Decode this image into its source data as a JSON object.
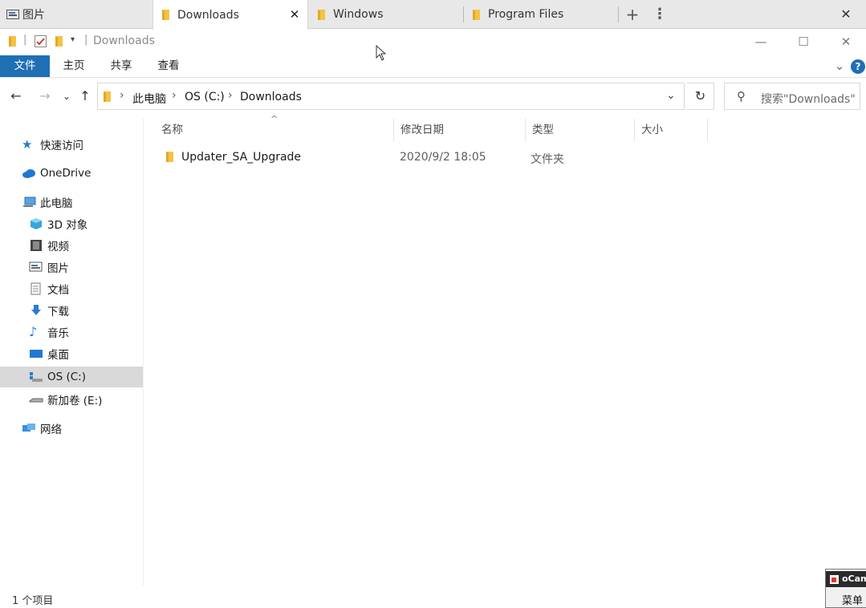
{
  "tabs": [
    {
      "label": "图片",
      "icon": "picture-icon",
      "active": false
    },
    {
      "label": "Downloads",
      "icon": "folder-icon",
      "active": true
    },
    {
      "label": "Windows",
      "icon": "folder-icon",
      "active": false
    },
    {
      "label": "Program Files",
      "icon": "folder-icon",
      "active": false
    }
  ],
  "tab_controls": {
    "close_tab": "✕",
    "new_tab": "+",
    "more": "⋮",
    "close_window": "✕"
  },
  "titlebar": {
    "title": "Downloads",
    "quick_access_divider": "|",
    "quick_access_more": "▾"
  },
  "window_buttons": {
    "minimize": "—",
    "maximize": "☐",
    "close": "✕"
  },
  "ribbon": {
    "tabs": [
      {
        "label": "文件"
      },
      {
        "label": "主页"
      },
      {
        "label": "共享"
      },
      {
        "label": "查看"
      }
    ],
    "expand": "⌄",
    "help": "?"
  },
  "navigation": {
    "back": "←",
    "forward": "→",
    "recent": "⌄",
    "up": "↑",
    "breadcrumb": [
      "此电脑",
      "OS (C:)",
      "Downloads"
    ],
    "breadcrumb_sep": "›",
    "dropdown": "⌄",
    "refresh": "↻",
    "search_placeholder": "搜索\"Downloads\"",
    "search_icon": "⚲"
  },
  "nav_pane": {
    "quick_access": "快速访问",
    "onedrive": "OneDrive",
    "this_pc": "此电脑",
    "items": [
      {
        "label": "3D 对象",
        "icon": "3d-objects-icon"
      },
      {
        "label": "视频",
        "icon": "video-icon"
      },
      {
        "label": "图片",
        "icon": "picture-icon"
      },
      {
        "label": "文档",
        "icon": "document-icon"
      },
      {
        "label": "下载",
        "icon": "download-icon"
      },
      {
        "label": "音乐",
        "icon": "music-icon"
      },
      {
        "label": "桌面",
        "icon": "desktop-icon"
      },
      {
        "label": "OS (C:)",
        "icon": "drive-icon",
        "selected": true
      },
      {
        "label": "新加卷 (E:)",
        "icon": "drive-icon"
      }
    ],
    "network": "网络"
  },
  "file_list": {
    "sort_indicator": "^",
    "columns": [
      "名称",
      "修改日期",
      "类型",
      "大小"
    ],
    "rows": [
      {
        "name": "Updater_SA_Upgrade",
        "modified": "2020/9/2 18:05",
        "type": "文件夹",
        "size": ""
      }
    ]
  },
  "statusbar": {
    "count": "1 个项目"
  },
  "ocam": {
    "title": "oCam",
    "menu": "菜单"
  },
  "colors": {
    "accent": "#1f6fb5",
    "folder": "#f5c342",
    "selected": "#d9d9d9"
  }
}
